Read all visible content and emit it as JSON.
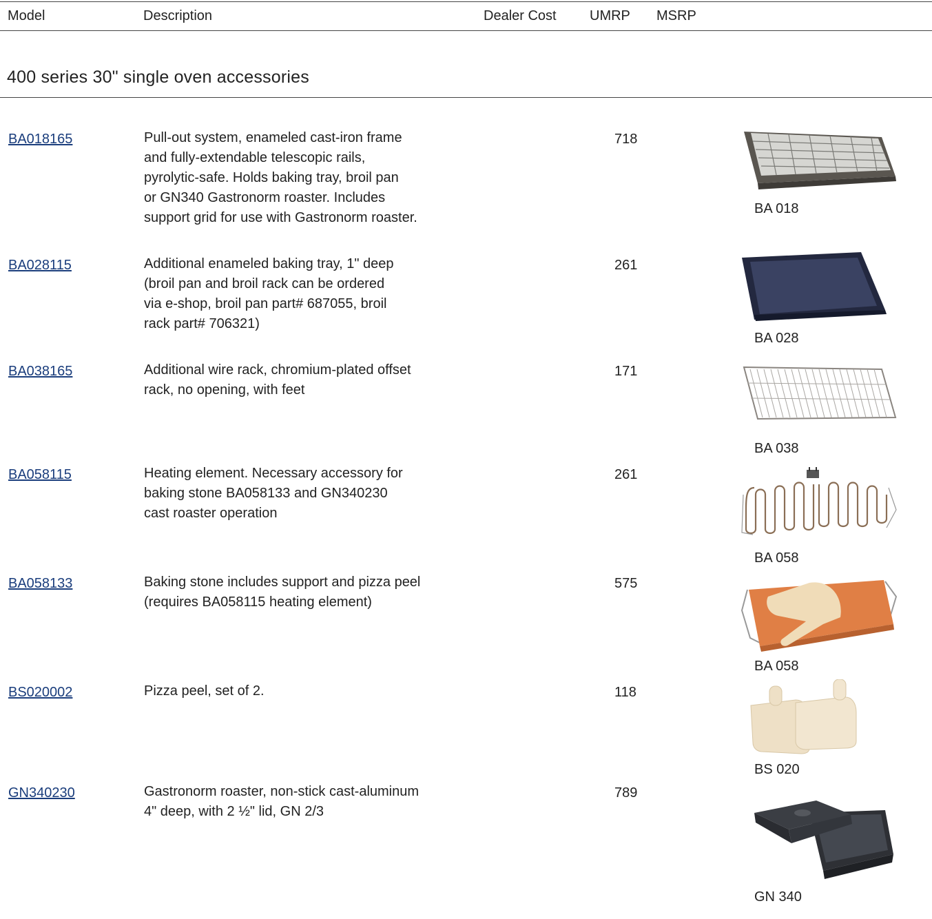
{
  "header": {
    "model": "Model",
    "description": "Description",
    "dealer_cost": "Dealer Cost",
    "umrp": "UMRP",
    "msrp": "MSRP"
  },
  "section_title": "400 series 30\" single oven accessories",
  "items": [
    {
      "model": "BA018165",
      "lines": [
        "Pull-out system, enameled cast-iron frame",
        "and fully-extendable telescopic rails,",
        "pyrolytic-safe. Holds baking tray, broil pan",
        "or GN340 Gastronorm roaster. Includes",
        "support grid for use with Gastronorm roaster."
      ],
      "umrp": "718",
      "caption": "BA 018",
      "icon": "pull-out-rack-icon"
    },
    {
      "model": "BA028115",
      "lines": [
        "Additional enameled baking tray, 1\" deep",
        "(broil pan and broil rack can be ordered",
        "via e-shop, broil pan part# 687055, broil",
        "rack part# 706321)"
      ],
      "umrp": "261",
      "caption": "BA 028",
      "icon": "baking-tray-icon"
    },
    {
      "model": "BA038165",
      "lines": [
        "Additional wire rack, chromium-plated offset",
        "rack, no opening, with feet"
      ],
      "umrp": "171",
      "caption": "BA 038",
      "icon": "wire-rack-icon"
    },
    {
      "model": "BA058115",
      "lines": [
        "Heating element. Necessary accessory for",
        "baking stone BA058133 and GN340230",
        "cast roaster operation"
      ],
      "umrp": "261",
      "caption": "BA 058",
      "icon": "heating-element-icon"
    },
    {
      "model": "BA058133",
      "lines": [
        "Baking stone includes support and pizza peel",
        "(requires BA058115 heating element)"
      ],
      "umrp": "575",
      "caption": "BA 058",
      "icon": "baking-stone-icon"
    },
    {
      "model": "BS020002",
      "lines": [
        "Pizza peel, set of 2."
      ],
      "umrp": "118",
      "caption": "BS 020",
      "icon": "pizza-peel-icon"
    },
    {
      "model": "GN340230",
      "lines": [
        "Gastronorm roaster, non-stick cast-aluminum",
        "4\" deep, with 2 ½\" lid, GN 2/3"
      ],
      "umrp": "789",
      "caption": "GN 340",
      "icon": "roaster-icon"
    }
  ]
}
